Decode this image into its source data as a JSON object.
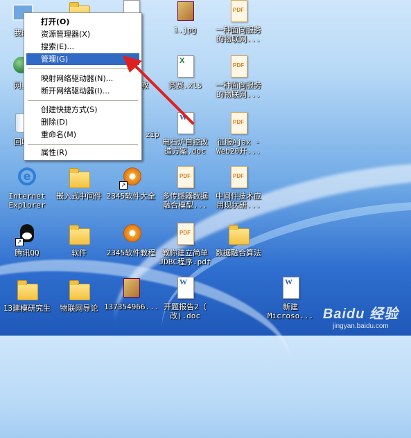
{
  "desktop_icons": {
    "my_computer": "我的",
    "network": "网上",
    "recycle": "回收",
    "ie": "Internet\nExplorer",
    "qq": "腾讯QQ",
    "modeling": "13建模研究生",
    "embedded": "嵌入式中间件",
    "software": "软件",
    "iot_guide": "物联网导论",
    "file_2345a": "2345软件大全",
    "file_2345b": "2345软件教程",
    "file_137": "137354966...",
    "jpg": "1.jpg",
    "teaching": "教",
    "competition": "竞赛.xls",
    "zip": "zip",
    "boiler": "电石炉自控改\n造方案.doc",
    "multisensor": "多传感器数据\n融合模型...",
    "jdbc": "教你建立简单\nJDBC程序.pdf",
    "report": "开题报告2（\n改).doc",
    "iot_service1": "一种面向服务\n的物联网...",
    "iot_service2": "一种面向服务\n的物联网...",
    "ajax": "征服Ajax -\nWeb20开...",
    "middleware": "中间件技术应\n用现状研...",
    "fusion": "数据融合算法",
    "new": "新建\nMicroso..."
  },
  "context_menu": {
    "open": "打开(O)",
    "explorer": "资源管理器(X)",
    "search": "搜索(E)...",
    "manage": "管理(G)",
    "map_drive": "映射网络驱动器(N)...",
    "disconnect": "断开网络驱动器(I)...",
    "shortcut": "创建快捷方式(S)",
    "delete": "删除(D)",
    "rename": "重命名(M)",
    "properties": "属性(R)"
  },
  "icon_types": {
    "pdf": "PDF",
    "word": "W",
    "excel": "X",
    "ie": "e",
    "shortcut": "↗"
  },
  "watermark": {
    "brand": "Baidu 经验",
    "url": "jingyan.baidu.com"
  },
  "colors": {
    "highlight": "#316ac5",
    "arrow": "#e02020"
  }
}
